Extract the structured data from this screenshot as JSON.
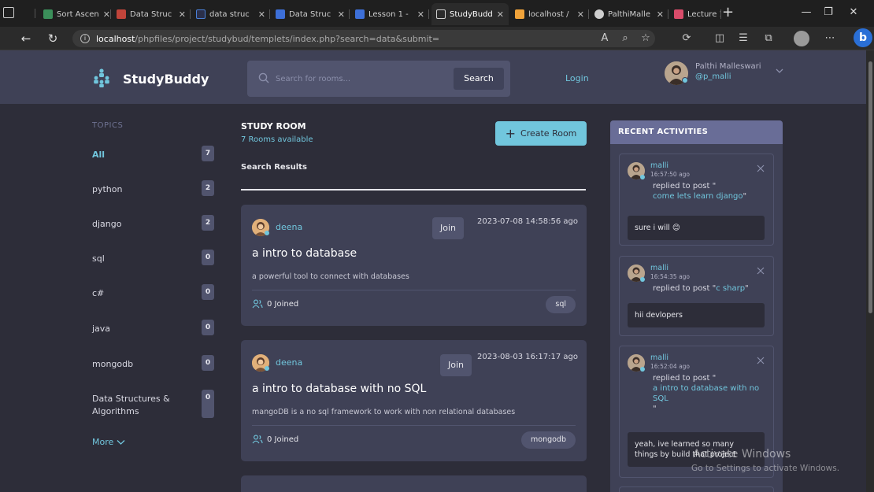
{
  "browser": {
    "tabs": [
      {
        "label": "Sort Ascen",
        "color": "#3b8f5a"
      },
      {
        "label": "Data Struc",
        "color": "#c0443a"
      },
      {
        "label": "data struc",
        "color": "#4a7fd6"
      },
      {
        "label": "Data Struc",
        "color": "#3d6fd8"
      },
      {
        "label": "Lesson 1 -",
        "color": "#3d6fd8"
      },
      {
        "label": "StudyBudd",
        "color": "#cfcfcf"
      },
      {
        "label": "localhost /",
        "color": "#f0a33a"
      },
      {
        "label": "PalthiMalle",
        "color": "#cfcfcf"
      },
      {
        "label": "Lecture 1 -",
        "color": "#d94c6a"
      }
    ],
    "url_host": "localhost",
    "url_path": "/phpfiles/project/studybud/templets/index.php?search=data&submit="
  },
  "header": {
    "brand": "StudyBuddy",
    "search_placeholder": "Search for rooms...",
    "search_button": "Search",
    "login": "Login",
    "user_name": "Palthi Malleswari",
    "user_handle": "@p_malli"
  },
  "topics": {
    "title": "TOPICS",
    "items": [
      {
        "label": "All",
        "count": "7"
      },
      {
        "label": "python",
        "count": "2"
      },
      {
        "label": "django",
        "count": "2"
      },
      {
        "label": "sql",
        "count": "0"
      },
      {
        "label": "c#",
        "count": "0"
      },
      {
        "label": "java",
        "count": "0"
      },
      {
        "label": "mongodb",
        "count": "0"
      },
      {
        "label": "Data Structures & Algorithms",
        "count": "0"
      }
    ],
    "more": "More"
  },
  "room": {
    "title": "STUDY ROOM",
    "subtitle": "7 Rooms available",
    "create": "Create Room",
    "results": "Search Results",
    "cards": [
      {
        "host": "deena",
        "join": "Join",
        "date": "2023-07-08 14:58:56 ago",
        "title": "a intro to database",
        "desc": "a powerful tool to connect with databases",
        "joined": "0 Joined",
        "tag": "sql"
      },
      {
        "host": "deena",
        "join": "Join",
        "date": "2023-08-03 16:17:17 ago",
        "title": "a intro to database with no SQL",
        "desc": "mangoDB is a no sql framework to work with non relational databases",
        "joined": "0 Joined",
        "tag": "mongodb"
      }
    ]
  },
  "activities": {
    "title": "RECENT ACTIVITIES",
    "items": [
      {
        "user": "malli",
        "time": "16:57:50 ago",
        "prefix": "replied to post \"",
        "post": "come lets learn django",
        "suffix": "\"",
        "message": "sure i will 😊"
      },
      {
        "user": "malli",
        "time": "16:54:35 ago",
        "prefix": "replied to post \"",
        "post": "c sharp",
        "suffix": "\"",
        "message": "hii devlopers"
      },
      {
        "user": "malli",
        "time": "16:52:04 ago",
        "prefix": "replied to post \"",
        "post": "a intro to database with no SQL",
        "suffix": "\"",
        "message": "yeah, ive learned so many things by build that project"
      }
    ]
  },
  "watermark": {
    "line1": "Activate Windows",
    "line2": "Go to Settings to activate Windows."
  },
  "colors": {
    "accent": "#71c6dd",
    "page_bg": "#2d2d39",
    "card_bg": "#3f4156",
    "activity_header": "#696d97"
  }
}
